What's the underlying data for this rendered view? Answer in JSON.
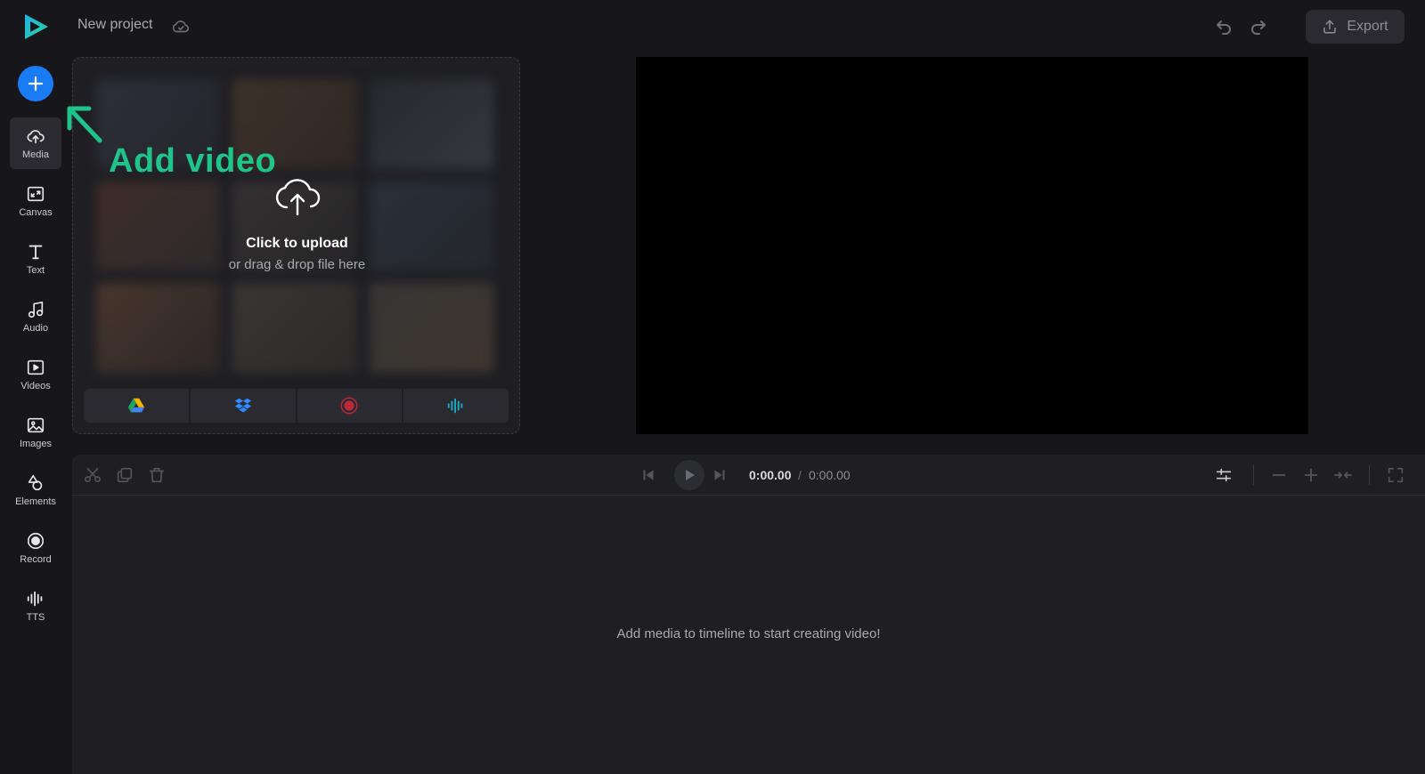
{
  "app": {
    "project_title": "New project",
    "brand_color": "#1fb1e6",
    "accent_color": "#1a7cf5",
    "hint_color": "#1fc48a"
  },
  "header": {
    "undo_icon": "undo-icon",
    "redo_icon": "redo-icon",
    "export_label": "Export",
    "save_status_icon": "cloud-check-icon"
  },
  "sidebar": {
    "add_icon": "plus-icon",
    "items": [
      {
        "label": "Media",
        "icon": "cloud-upload-icon",
        "active": true
      },
      {
        "label": "Canvas",
        "icon": "canvas-icon",
        "active": false
      },
      {
        "label": "Text",
        "icon": "text-icon",
        "active": false
      },
      {
        "label": "Audio",
        "icon": "music-note-icon",
        "active": false
      },
      {
        "label": "Videos",
        "icon": "video-play-icon",
        "active": false
      },
      {
        "label": "Images",
        "icon": "image-icon",
        "active": false
      },
      {
        "label": "Elements",
        "icon": "shapes-icon",
        "active": false
      },
      {
        "label": "Record",
        "icon": "record-icon",
        "active": false
      },
      {
        "label": "TTS",
        "icon": "waveform-icon",
        "active": false
      }
    ]
  },
  "media_panel": {
    "upload_title": "Click to upload",
    "upload_subtitle": "or drag & drop file here",
    "sources": [
      "google-drive-icon",
      "dropbox-icon",
      "record-icon",
      "waveform-icon"
    ]
  },
  "hint": {
    "text": "Add video"
  },
  "timeline": {
    "current_time": "0:00.00",
    "separator": "/",
    "total_time": "0:00.00",
    "empty_message": "Add media to timeline to start creating video!"
  }
}
